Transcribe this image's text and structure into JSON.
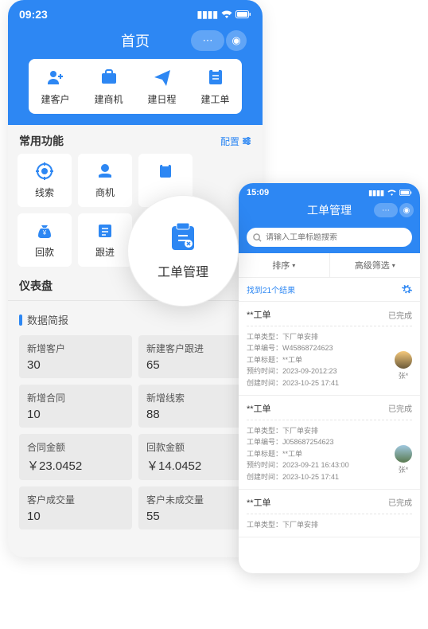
{
  "phone1": {
    "time": "09:23",
    "title": "首页",
    "quick": [
      {
        "label": "建客户",
        "icon": "user-plus"
      },
      {
        "label": "建商机",
        "icon": "briefcase"
      },
      {
        "label": "建日程",
        "icon": "send"
      },
      {
        "label": "建工单",
        "icon": "ticket"
      }
    ],
    "commonSection": "常用功能",
    "configLabel": "配置",
    "funcs": [
      {
        "label": "线索",
        "icon": "target"
      },
      {
        "label": "商机",
        "icon": "money-hand"
      },
      {
        "label": "",
        "icon": "clipboard"
      },
      {
        "label": "",
        "icon": ""
      },
      {
        "label": "回款",
        "icon": "money-bag"
      },
      {
        "label": "跟进",
        "icon": "note"
      },
      {
        "label": "",
        "icon": ""
      },
      {
        "label": "",
        "icon": ""
      }
    ],
    "dashTitle": "仪表盘",
    "dashSub": "数据简报",
    "stats": [
      {
        "label": "新增客户",
        "value": "30"
      },
      {
        "label": "新建客户跟进",
        "value": "65"
      },
      {
        "label": "新增合同",
        "value": "10"
      },
      {
        "label": "新增线索",
        "value": "88"
      },
      {
        "label": "合同金额",
        "value": "￥23.0452"
      },
      {
        "label": "回款金额",
        "value": "￥14.0452"
      },
      {
        "label": "客户成交量",
        "value": "10"
      },
      {
        "label": "客户未成交量",
        "value": "55"
      }
    ]
  },
  "bubble": {
    "label": "工单管理"
  },
  "phone2": {
    "time": "15:09",
    "title": "工单管理",
    "searchPlaceholder": "请输入工单标题搜索",
    "sortLabel": "排序",
    "filterLabel": "高级筛选",
    "resultText": "找到21个结果",
    "items": [
      {
        "title": "**工单",
        "status": "已完成",
        "type": "工单类型：下厂单安排",
        "no": "工单编号：W45868724623",
        "subject": "工单标题：**工单",
        "appt": "预约时间：2023-09-2012:23",
        "created": "创建时间：2023-10-25 17:41",
        "user": "张*"
      },
      {
        "title": "**工单",
        "status": "已完成",
        "type": "工单类型：下厂单安排",
        "no": "工单编号：J058687254623",
        "subject": "工单标题：**工单",
        "appt": "预约时间：2023-09-21 16:43:00",
        "created": "创建时间：2023-10-25 17:41",
        "user": "张*"
      },
      {
        "title": "**工单",
        "status": "已完成",
        "type": "工单类型：下厂单安排",
        "no": "",
        "subject": "",
        "appt": "",
        "created": "",
        "user": ""
      }
    ]
  }
}
